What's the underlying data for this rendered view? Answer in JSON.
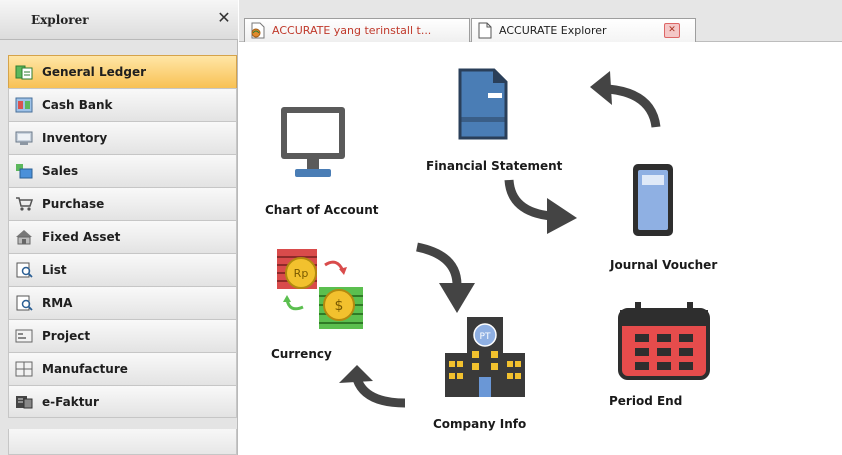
{
  "sidebar": {
    "title": "Explorer",
    "close_icon": "close-icon",
    "items": [
      {
        "label": "General Ledger",
        "icon": "general-ledger-icon",
        "active": true
      },
      {
        "label": "Cash Bank",
        "icon": "cash-bank-icon"
      },
      {
        "label": "Inventory",
        "icon": "inventory-icon"
      },
      {
        "label": "Sales",
        "icon": "sales-icon"
      },
      {
        "label": "Purchase",
        "icon": "purchase-icon"
      },
      {
        "label": "Fixed Asset",
        "icon": "fixed-asset-icon"
      },
      {
        "label": "List",
        "icon": "list-icon"
      },
      {
        "label": "RMA",
        "icon": "rma-icon"
      },
      {
        "label": "Project",
        "icon": "project-icon"
      },
      {
        "label": "Manufacture",
        "icon": "manufacture-icon"
      },
      {
        "label": "e-Faktur",
        "icon": "e-faktur-icon"
      }
    ]
  },
  "tabs": [
    {
      "label": "ACCURATE yang terinstall t...",
      "icon": "web-page-icon"
    },
    {
      "label": "ACCURATE Explorer",
      "icon": "document-icon",
      "active": true
    }
  ],
  "flow": {
    "chart_of_account": {
      "label": "Chart of Account",
      "icon": "monitor-icon"
    },
    "financial_statement": {
      "label": "Financial Statement",
      "icon": "document-icon"
    },
    "journal_voucher": {
      "label": "Journal Voucher",
      "icon": "voucher-icon"
    },
    "period_end": {
      "label": "Period End",
      "icon": "calendar-icon"
    },
    "company_info": {
      "label": "Company Info",
      "icon": "building-icon",
      "badge": "PT"
    },
    "currency": {
      "label": "Currency",
      "icon": "currency-exchange-icon",
      "coin_text": "Rp"
    }
  },
  "colors": {
    "active_nav": "#f8c154",
    "tab_label_red": "#c0392b",
    "arrow": "#444444",
    "doc_blue": "#4a7db5",
    "calendar_red": "#e64c4c"
  }
}
